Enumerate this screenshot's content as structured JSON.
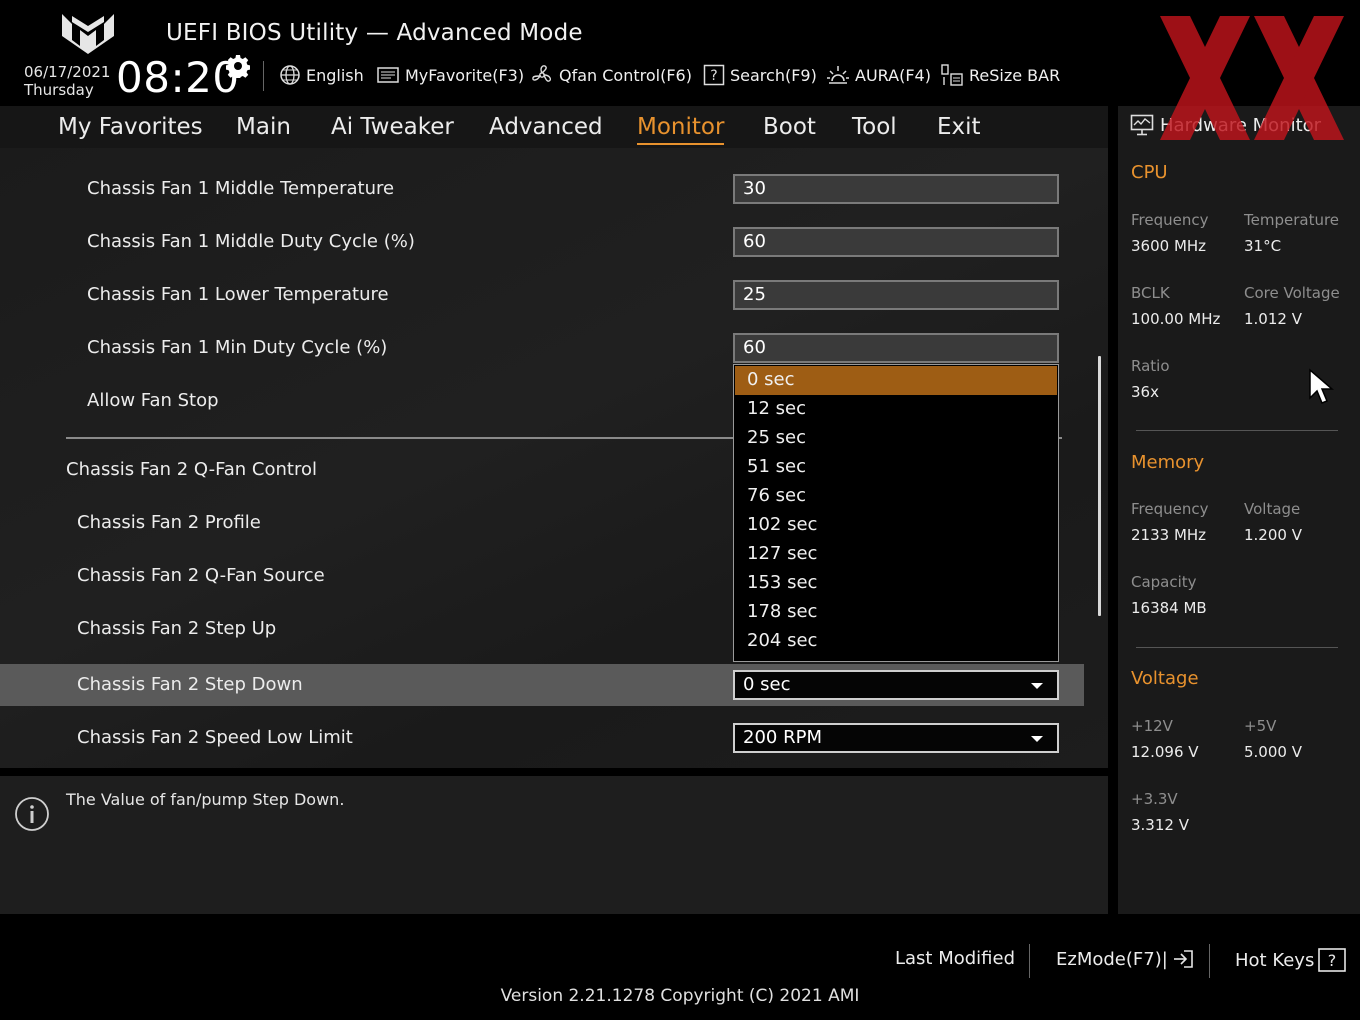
{
  "header": {
    "title": "UEFI BIOS Utility — Advanced Mode",
    "date": "06/17/2021",
    "day": "Thursday",
    "time": "08:20",
    "tools": [
      {
        "label": "English",
        "icon": "globe-icon"
      },
      {
        "label": "MyFavorite(F3)",
        "icon": "favorite-list-icon"
      },
      {
        "label": "Qfan Control(F6)",
        "icon": "fan-icon"
      },
      {
        "label": "Search(F9)",
        "icon": "search-help-icon"
      },
      {
        "label": "AURA(F4)",
        "icon": "aura-light-icon"
      },
      {
        "label": "ReSize BAR",
        "icon": "resize-bar-icon"
      }
    ]
  },
  "nav": {
    "tabs": [
      {
        "label": "My Favorites"
      },
      {
        "label": "Main"
      },
      {
        "label": "Ai Tweaker"
      },
      {
        "label": "Advanced"
      },
      {
        "label": "Monitor",
        "active": true
      },
      {
        "label": "Boot"
      },
      {
        "label": "Tool"
      },
      {
        "label": "Exit"
      }
    ]
  },
  "settings": [
    {
      "label": "Chassis Fan 1 Middle Temperature",
      "value": "30",
      "kind": "text"
    },
    {
      "label": "Chassis Fan 1 Middle Duty Cycle (%)",
      "value": "60",
      "kind": "text"
    },
    {
      "label": "Chassis Fan 1 Lower Temperature",
      "value": "25",
      "kind": "text"
    },
    {
      "label": "Chassis Fan 1 Min Duty Cycle (%)",
      "value": "60",
      "kind": "text"
    },
    {
      "label": "Allow Fan Stop",
      "value": "",
      "kind": "hidden"
    },
    {
      "label": "Chassis Fan 2 Q-Fan Control",
      "value": "",
      "kind": "hidden"
    },
    {
      "label": "Chassis Fan 2 Profile",
      "value": "",
      "kind": "hidden"
    },
    {
      "label": "Chassis Fan 2 Q-Fan Source",
      "value": "",
      "kind": "hidden"
    },
    {
      "label": "Chassis Fan 2 Step Up",
      "value": "",
      "kind": "hidden"
    },
    {
      "label": "Chassis Fan 2 Step Down",
      "value": "0 sec",
      "kind": "select",
      "selected": true
    },
    {
      "label": "Chassis Fan 2 Speed Low Limit",
      "value": "200 RPM",
      "kind": "select"
    }
  ],
  "dropdown": {
    "options": [
      "0 sec",
      "12 sec",
      "25 sec",
      "51 sec",
      "76 sec",
      "102 sec",
      "127 sec",
      "153 sec",
      "178 sec",
      "204 sec"
    ],
    "selected_index": 0
  },
  "help": {
    "text": "The Value of fan/pump Step Down."
  },
  "hardware_monitor": {
    "title": "Hardware Monitor",
    "cpu": {
      "heading": "CPU",
      "frequency_label": "Frequency",
      "frequency": "3600 MHz",
      "temperature_label": "Temperature",
      "temperature": "31°C",
      "bclk_label": "BCLK",
      "bclk": "100.00 MHz",
      "core_voltage_label": "Core Voltage",
      "core_voltage": "1.012 V",
      "ratio_label": "Ratio",
      "ratio": "36x"
    },
    "memory": {
      "heading": "Memory",
      "frequency_label": "Frequency",
      "frequency": "2133 MHz",
      "voltage_label": "Voltage",
      "voltage": "1.200 V",
      "capacity_label": "Capacity",
      "capacity": "16384 MB"
    },
    "voltage": {
      "heading": "Voltage",
      "v12_label": "+12V",
      "v12": "12.096 V",
      "v5_label": "+5V",
      "v5": "5.000 V",
      "v33_label": "+3.3V",
      "v33": "3.312 V"
    }
  },
  "footer": {
    "last_modified": "Last Modified",
    "ezmode": "EzMode(F7)|",
    "hot_keys": "Hot Keys",
    "version": "Version 2.21.1278 Copyright (C) 2021 AMI"
  },
  "colors": {
    "accent": "#e8922e",
    "selected_option": "#9e5d14",
    "selected_row": "#5a5a5a",
    "watermark": "#c0141c"
  }
}
